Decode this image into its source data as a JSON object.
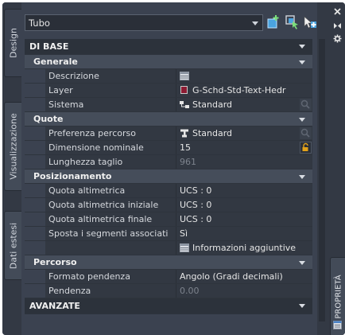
{
  "palette": {
    "window_bg": "#333944",
    "panel_bg": "#3b4250",
    "category_bg": "#2c323b",
    "subcategory_bg": "#454d5a",
    "layer_swatch": "#8c1b33"
  },
  "tabs": {
    "left": [
      "Design",
      "Visualizzazione",
      "Dati estesi"
    ],
    "right": "PROPRIETÀ"
  },
  "selector": {
    "value": "Tubo"
  },
  "toolbar_icons": [
    "add-selection-icon",
    "quick-select-icon",
    "toggle-pickadd-icon"
  ],
  "window_controls": [
    "close-icon",
    "autohide-icon",
    "settings-icon"
  ],
  "sections": {
    "di_base": "DI BASE",
    "generale": "Generale",
    "quote": "Quote",
    "posizionamento": "Posizionamento",
    "percorso": "Percorso",
    "avanzate": "AVANZATE"
  },
  "props": {
    "descrizione": {
      "name": "Descrizione",
      "value": ""
    },
    "layer": {
      "name": "Layer",
      "value": "G-Schd-Std-Text-Hedr"
    },
    "sistema": {
      "name": "Sistema",
      "value": "Standard"
    },
    "preferenza": {
      "name": "Preferenza percorso",
      "value": "Standard"
    },
    "dimensione": {
      "name": "Dimensione nominale",
      "value": "15"
    },
    "lunghezza": {
      "name": "Lunghezza taglio",
      "value": "961"
    },
    "quota_alt": {
      "name": "Quota altimetrica",
      "value": "UCS : 0"
    },
    "quota_iniz": {
      "name": "Quota altimetrica iniziale",
      "value": "UCS : 0"
    },
    "quota_fin": {
      "name": "Quota altimetrica finale",
      "value": "UCS : 0"
    },
    "sposta": {
      "name": "Sposta i segmenti associati",
      "value": "Sì"
    },
    "info": {
      "value": "Informazioni aggiuntive"
    },
    "formato": {
      "name": "Formato pendenza",
      "value": "Angolo (Gradi decimali)"
    },
    "pendenza": {
      "name": "Pendenza",
      "value": "0.00"
    }
  }
}
